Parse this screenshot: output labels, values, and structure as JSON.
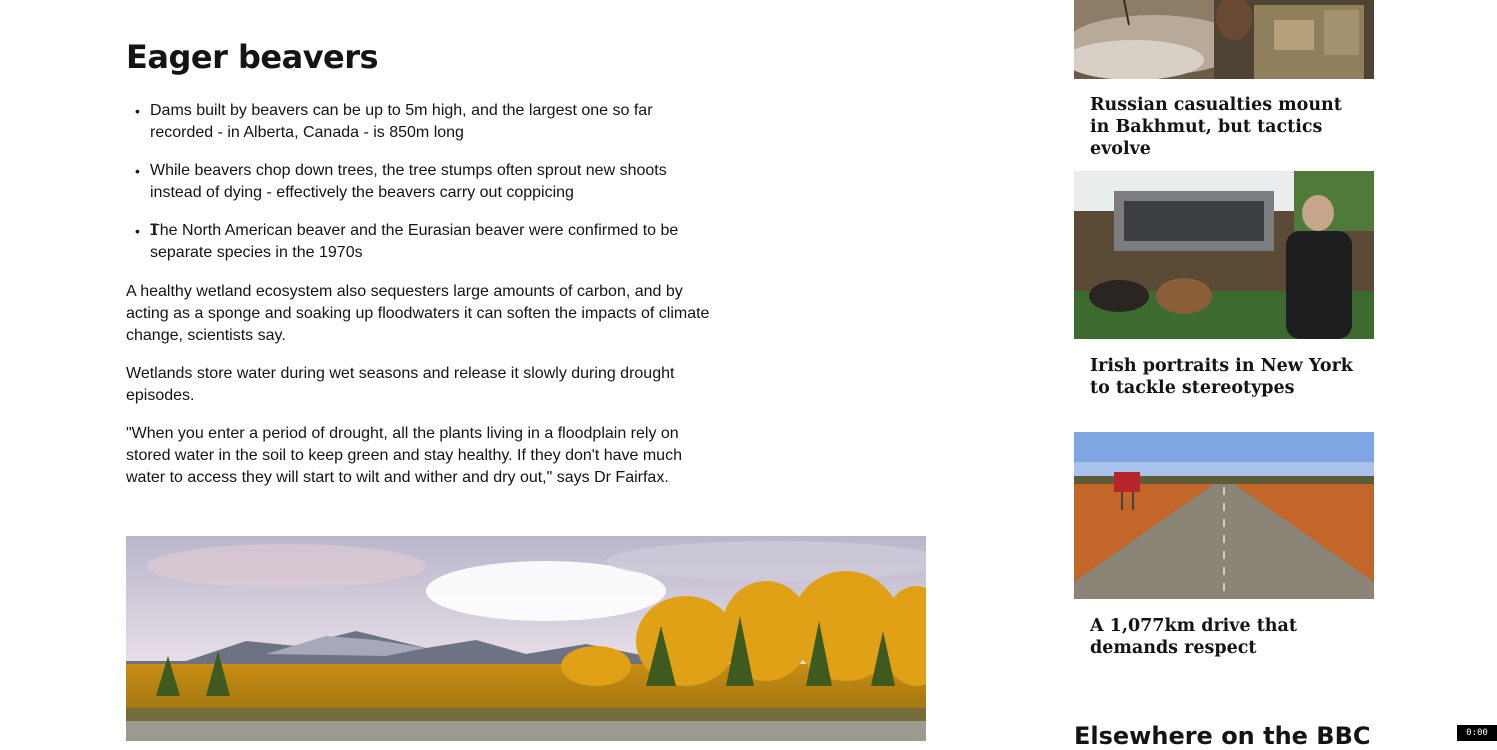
{
  "article": {
    "heading": "Eager beavers",
    "bullets": [
      "Dams built by beavers can be up to 5m high, and the largest one so far recorded - in Alberta, Canada - is 850m long",
      "While beavers chop down trees, the tree stumps often sprout new shoots instead of dying - effectively the beavers carry out coppicing",
      "The North American beaver and the Eurasian beaver were confirmed to be separate species in the 1970s"
    ],
    "paragraphs": [
      "A healthy wetland ecosystem also sequesters large amounts of carbon, and by acting as a sponge and soaking up floodwaters it can soften the impacts of climate change, scientists say.",
      "Wetlands store water during wet seasons and release it slowly during drought episodes.",
      "\"When you enter a period of drought, all the plants living in a floodplain rely on stored water in the soil to keep green and stay healthy. If they don't have much water to access they will start to wilt and wither and dry out,\" says Dr Fairfax."
    ]
  },
  "rail": {
    "cards": [
      {
        "title": "Russian casualties mount in Bakhmut, but tactics evolve"
      },
      {
        "title": "Irish portraits in New York to tackle stereotypes"
      },
      {
        "title": "A 1,077km drive that demands respect"
      }
    ],
    "elsewhere_heading": "Elsewhere on the BBC"
  },
  "gif_timer": "0:00"
}
